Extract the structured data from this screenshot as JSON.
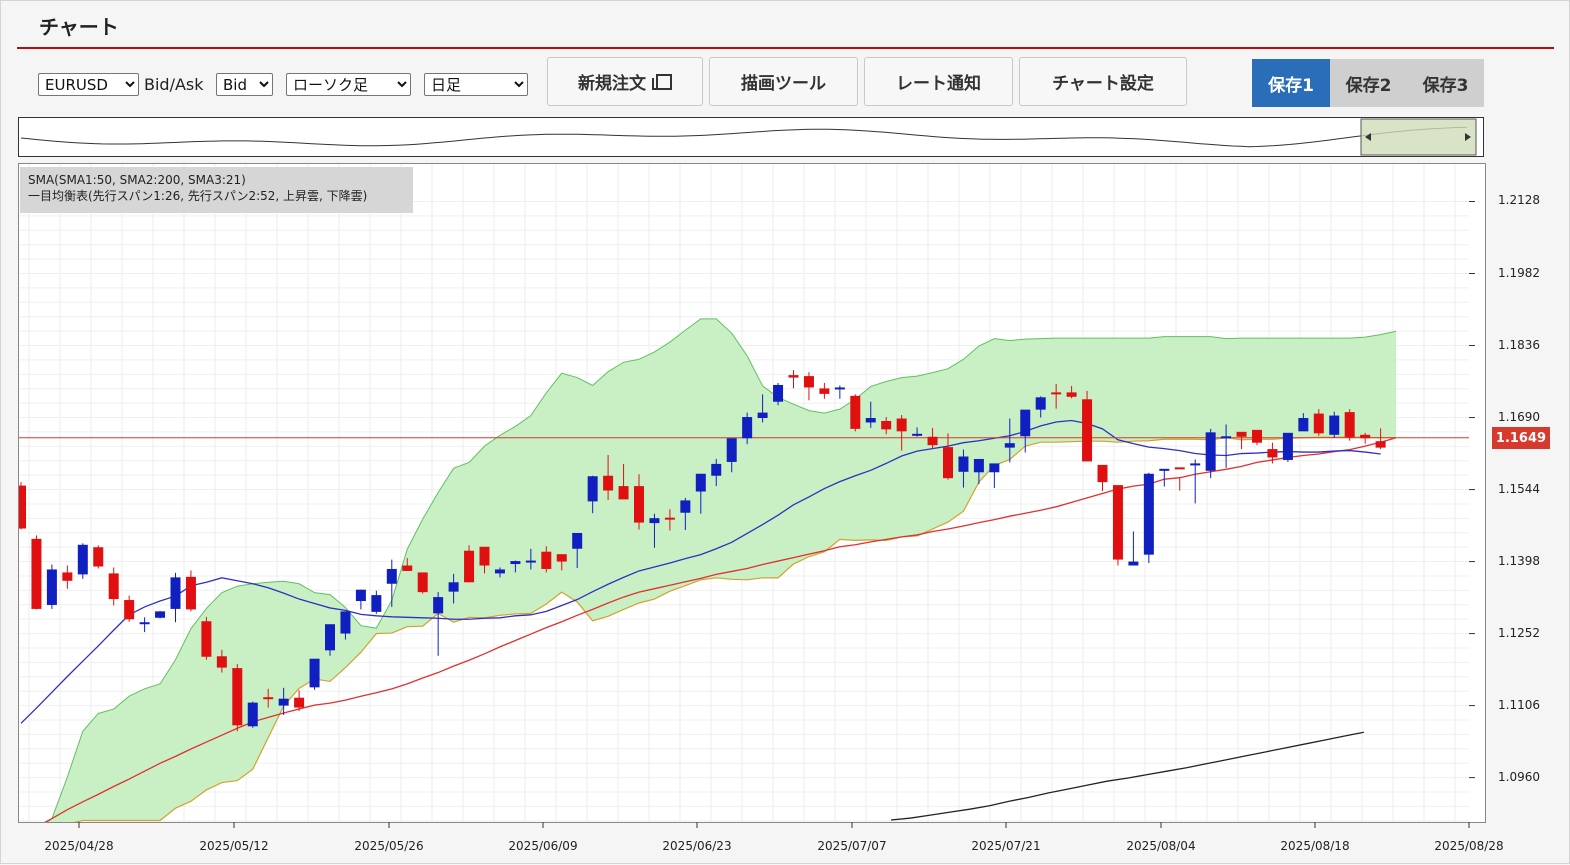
{
  "app": {
    "title": "チャート"
  },
  "toolbar": {
    "symbol": "EURUSD",
    "bidask_label": "Bid/Ask",
    "bidask_value": "Bid",
    "chart_type": "ローソク足",
    "timeframe": "日足",
    "new_order_label": "新規注文",
    "drawing_tools_label": "描画ツール",
    "rate_alert_label": "レート通知",
    "chart_settings_label": "チャート設定",
    "save_slots": [
      "保存1",
      "保存2",
      "保存3"
    ],
    "active_save_slot": "保存1"
  },
  "indicators": {
    "line1": "SMA(SMA1:50, SMA2:200, SMA3:21)",
    "line2": "一目均衡表(先行スパン1:26, 先行スパン2:52, 上昇雲, 下降雲)"
  },
  "current_price": "1.1649",
  "colors": {
    "accent": "#2a6db8",
    "title_rule": "#b01010",
    "bull": "#1020c0",
    "bear": "#e01010",
    "cloud": "#c9f0c4",
    "sma_blue": "#3030c0",
    "sma_red": "#e03030",
    "span2": "#d4a030",
    "price_line": "#d63a2e"
  },
  "chart_data": {
    "type": "candlestick",
    "x_ticks": [
      "2025/04/28",
      "2025/05/12",
      "2025/05/26",
      "2025/06/09",
      "2025/06/23",
      "2025/07/07",
      "2025/07/21",
      "2025/08/04",
      "2025/08/18",
      "2025/08/28"
    ],
    "y_ticks": [
      "1.2128",
      "1.1982",
      "1.1836",
      "1.1690",
      "1.1544",
      "1.1398",
      "1.1252",
      "1.1106",
      "1.0960"
    ],
    "ylim": [
      1.087,
      1.2204
    ],
    "ohlc": [
      [
        1.1552,
        1.1559,
        1.1463,
        1.1465
      ],
      [
        1.1444,
        1.1451,
        1.1301,
        1.1302
      ],
      [
        1.131,
        1.1392,
        1.1302,
        1.1382
      ],
      [
        1.1376,
        1.139,
        1.1343,
        1.1359
      ],
      [
        1.1372,
        1.1435,
        1.1363,
        1.1432
      ],
      [
        1.1427,
        1.1431,
        1.1384,
        1.1388
      ],
      [
        1.1374,
        1.1386,
        1.1309,
        1.1322
      ],
      [
        1.132,
        1.1329,
        1.1276,
        1.1281
      ],
      [
        1.1271,
        1.1285,
        1.1255,
        1.1275
      ],
      [
        1.1284,
        1.1298,
        1.1283,
        1.1297
      ],
      [
        1.1302,
        1.1375,
        1.1275,
        1.1366
      ],
      [
        1.1367,
        1.138,
        1.1297,
        1.1301
      ],
      [
        1.1277,
        1.1286,
        1.1199,
        1.1205
      ],
      [
        1.1206,
        1.1219,
        1.1173,
        1.1183
      ],
      [
        1.1182,
        1.119,
        1.1054,
        1.1066
      ],
      [
        1.1064,
        1.1114,
        1.1061,
        1.1112
      ],
      [
        1.1123,
        1.114,
        1.1102,
        1.112
      ],
      [
        1.1106,
        1.1142,
        1.1087,
        1.112
      ],
      [
        1.1122,
        1.1137,
        1.1095,
        1.1102
      ],
      [
        1.1143,
        1.1183,
        1.1138,
        1.1201
      ],
      [
        1.1218,
        1.1261,
        1.1207,
        1.1271
      ],
      [
        1.1252,
        1.1292,
        1.124,
        1.1297
      ],
      [
        1.1318,
        1.1341,
        1.1301,
        1.1341
      ],
      [
        1.1296,
        1.1339,
        1.1292,
        1.133
      ],
      [
        1.1353,
        1.1402,
        1.1306,
        1.1383
      ],
      [
        1.139,
        1.1405,
        1.1379,
        1.1379
      ],
      [
        1.1376,
        1.1373,
        1.1333,
        1.1336
      ],
      [
        1.1293,
        1.1336,
        1.1207,
        1.1326
      ],
      [
        1.1337,
        1.1373,
        1.1313,
        1.1356
      ],
      [
        1.142,
        1.1431,
        1.1356,
        1.1356
      ],
      [
        1.1428,
        1.1416,
        1.1374,
        1.139
      ],
      [
        1.1374,
        1.1386,
        1.1366,
        1.1382
      ],
      [
        1.1393,
        1.14,
        1.1376,
        1.1399
      ],
      [
        1.1397,
        1.1424,
        1.1382,
        1.14
      ],
      [
        1.1418,
        1.1429,
        1.1376,
        1.1383
      ],
      [
        1.1413,
        1.1412,
        1.138,
        1.1398
      ],
      [
        1.1424,
        1.1451,
        1.1385,
        1.1456
      ],
      [
        1.152,
        1.1572,
        1.1496,
        1.1571
      ],
      [
        1.1572,
        1.1614,
        1.1523,
        1.1542
      ],
      [
        1.1551,
        1.1596,
        1.1527,
        1.1524
      ],
      [
        1.1551,
        1.1575,
        1.1463,
        1.1477
      ],
      [
        1.1476,
        1.1495,
        1.1426,
        1.1486
      ],
      [
        1.1487,
        1.1504,
        1.1461,
        1.1485
      ],
      [
        1.1497,
        1.1527,
        1.1462,
        1.1522
      ],
      [
        1.154,
        1.1576,
        1.1495,
        1.1576
      ],
      [
        1.1572,
        1.1606,
        1.1551,
        1.1596
      ],
      [
        1.16,
        1.1648,
        1.1579,
        1.1648
      ],
      [
        1.1648,
        1.17,
        1.1636,
        1.1691
      ],
      [
        1.1689,
        1.1737,
        1.168,
        1.17
      ],
      [
        1.1722,
        1.176,
        1.1715,
        1.1756
      ],
      [
        1.1776,
        1.1786,
        1.1749,
        1.1771
      ],
      [
        1.1774,
        1.1782,
        1.1725,
        1.1751
      ],
      [
        1.1749,
        1.176,
        1.1728,
        1.1738
      ],
      [
        1.1747,
        1.1755,
        1.1728,
        1.1751
      ],
      [
        1.1734,
        1.1737,
        1.1662,
        1.1667
      ],
      [
        1.168,
        1.1722,
        1.1669,
        1.1689
      ],
      [
        1.1683,
        1.1691,
        1.1656,
        1.1666
      ],
      [
        1.1688,
        1.1695,
        1.1623,
        1.1662
      ],
      [
        1.1657,
        1.167,
        1.1651,
        1.1657
      ],
      [
        1.1651,
        1.1669,
        1.1627,
        1.1634
      ],
      [
        1.163,
        1.1658,
        1.1564,
        1.1567
      ],
      [
        1.158,
        1.1625,
        1.1548,
        1.1611
      ],
      [
        1.1579,
        1.1597,
        1.1555,
        1.1606
      ],
      [
        1.1579,
        1.1588,
        1.1547,
        1.1597
      ],
      [
        1.1629,
        1.1688,
        1.1599,
        1.1638
      ],
      [
        1.1652,
        1.1687,
        1.1619,
        1.1706
      ],
      [
        1.1706,
        1.1733,
        1.169,
        1.1731
      ],
      [
        1.1741,
        1.1758,
        1.1708,
        1.1737
      ],
      [
        1.1741,
        1.1754,
        1.1729,
        1.1732
      ],
      [
        1.1727,
        1.1744,
        1.1616,
        1.1601
      ],
      [
        1.1594,
        1.1562,
        1.1541,
        1.1559
      ],
      [
        1.1553,
        1.155,
        1.139,
        1.1402
      ],
      [
        1.139,
        1.1459,
        1.1395,
        1.1398
      ],
      [
        1.1412,
        1.1578,
        1.1395,
        1.1576
      ],
      [
        1.1582,
        1.1585,
        1.155,
        1.1586
      ],
      [
        1.1589,
        1.1567,
        1.1542,
        1.1586
      ],
      [
        1.1597,
        1.1605,
        1.1516,
        1.1597
      ],
      [
        1.1582,
        1.1667,
        1.1567,
        1.166
      ],
      [
        1.165,
        1.1676,
        1.1588,
        1.1652
      ],
      [
        1.1661,
        1.1659,
        1.1626,
        1.1651
      ],
      [
        1.1665,
        1.1659,
        1.1634,
        1.1639
      ],
      [
        1.1626,
        1.1639,
        1.1597,
        1.1609
      ],
      [
        1.1604,
        1.1622,
        1.16,
        1.1659
      ],
      [
        1.1662,
        1.1699,
        1.1678,
        1.1689
      ],
      [
        1.1698,
        1.1707,
        1.1653,
        1.1658
      ],
      [
        1.1655,
        1.1702,
        1.1649,
        1.1694
      ],
      [
        1.1701,
        1.1707,
        1.1643,
        1.165
      ],
      [
        1.1655,
        1.1659,
        1.1637,
        1.1648
      ],
      [
        1.1642,
        1.1668,
        1.1626,
        1.1629
      ]
    ],
    "sma21": [
      1.107,
      1.1101,
      1.1133,
      1.1165,
      1.1196,
      1.1227,
      1.1259,
      1.129,
      1.1306,
      1.1318,
      1.1328,
      1.1349,
      1.1356,
      1.1365,
      1.1359,
      1.1353,
      1.1345,
      1.1334,
      1.1322,
      1.1313,
      1.1304,
      1.1299,
      1.1291,
      1.1288,
      1.1286,
      1.1285,
      1.1284,
      1.1283,
      1.1281,
      1.1281,
      1.1283,
      1.1284,
      1.1288,
      1.129,
      1.1297,
      1.1309,
      1.1321,
      1.1337,
      1.1352,
      1.1366,
      1.1379,
      1.1387,
      1.1395,
      1.1404,
      1.1412,
      1.1424,
      1.1437,
      1.1455,
      1.1473,
      1.1492,
      1.1513,
      1.1529,
      1.1546,
      1.156,
      1.1572,
      1.1583,
      1.1597,
      1.1612,
      1.1622,
      1.1627,
      1.1632,
      1.1639,
      1.1643,
      1.1648,
      1.1653,
      1.1662,
      1.1673,
      1.1681,
      1.1684,
      1.1678,
      1.1667,
      1.1645,
      1.1637,
      1.163,
      1.1627,
      1.1623,
      1.1617,
      1.1614,
      1.1613,
      1.1617,
      1.1618,
      1.162,
      1.1621,
      1.162,
      1.162,
      1.1622,
      1.1623,
      1.162,
      1.1616
    ],
    "sma50": [
      1.0843,
      1.086,
      1.0877,
      1.0895,
      1.0911,
      1.0926,
      1.0942,
      1.0957,
      1.0973,
      1.0989,
      1.1003,
      1.1018,
      1.1032,
      1.1046,
      1.106,
      1.1073,
      1.1082,
      1.1091,
      1.1099,
      1.1107,
      1.1111,
      1.1117,
      1.1125,
      1.1132,
      1.114,
      1.115,
      1.1162,
      1.1173,
      1.1186,
      1.1198,
      1.1211,
      1.1225,
      1.1238,
      1.1251,
      1.1264,
      1.1276,
      1.1289,
      1.1301,
      1.1314,
      1.1326,
      1.1336,
      1.1343,
      1.135,
      1.1357,
      1.1364,
      1.1372,
      1.1378,
      1.1384,
      1.1392,
      1.1399,
      1.1406,
      1.1413,
      1.142,
      1.1428,
      1.1432,
      1.1438,
      1.1443,
      1.1448,
      1.1452,
      1.1459,
      1.1464,
      1.147,
      1.1477,
      1.1483,
      1.149,
      1.1496,
      1.1502,
      1.1509,
      1.1518,
      1.1527,
      1.1536,
      1.1545,
      1.1551,
      1.1555,
      1.1565,
      1.1568,
      1.1575,
      1.158,
      1.1585,
      1.1591,
      1.1599,
      1.1604,
      1.1609,
      1.1613,
      1.1616,
      1.1621,
      1.1625,
      1.1632,
      1.164,
      1.1649
    ],
    "sma200_segment": [
      [
        1.0874,
        1.0878,
        1.0884,
        1.089,
        1.0896,
        1.0903,
        1.0912,
        1.092,
        1.0929,
        1.0937,
        1.0945,
        1.0953,
        1.0959,
        1.0966,
        1.0973,
        1.098,
        1.0988,
        1.0996,
        1.1004,
        1.1012,
        1.102,
        1.1028,
        1.1036,
        1.1044,
        1.1052
      ]
    ],
    "senkou_span1": [
      1.086,
      1.0853,
      1.0877,
      1.0961,
      1.1054,
      1.109,
      1.1099,
      1.1125,
      1.114,
      1.115,
      1.1199,
      1.1262,
      1.1303,
      1.1335,
      1.1348,
      1.1353,
      1.1356,
      1.1358,
      1.1353,
      1.1335,
      1.1331,
      1.1305,
      1.1268,
      1.1263,
      1.1253,
      1.1266,
      1.1267,
      1.1293,
      1.1275,
      1.1285,
      1.1284,
      1.1289,
      1.1292,
      1.1293,
      1.1312,
      1.1336,
      1.1316,
      1.1278,
      1.1287,
      1.1301,
      1.1314,
      1.1322,
      1.1338,
      1.1349,
      1.1361,
      1.1365,
      1.1362,
      1.1361,
      1.1365,
      1.1365,
      1.1393,
      1.1408,
      1.1418,
      1.1443,
      1.1441,
      1.1442,
      1.1441,
      1.1448,
      1.145,
      1.1464,
      1.1478,
      1.15,
      1.1559,
      1.1593,
      1.1605,
      1.1632,
      1.164,
      1.164,
      1.1641,
      1.1642,
      1.1642,
      1.164,
      1.1642,
      1.1643,
      1.1646,
      1.1646,
      1.1646,
      1.1645,
      1.1649,
      1.1645,
      1.1646,
      1.1646,
      1.1648,
      1.1649,
      1.165,
      1.165,
      1.165,
      1.165,
      1.1649,
      1.1649
    ],
    "senkou_span2": [
      1.0837,
      1.0844,
      1.0864,
      1.0866,
      1.0873,
      1.0873,
      1.0873,
      1.0873,
      1.0873,
      1.0873,
      1.0898,
      1.0912,
      1.0935,
      1.095,
      1.0954,
      1.0977,
      1.1041,
      1.1105,
      1.1141,
      1.116,
      1.1155,
      1.1183,
      1.1214,
      1.1252,
      1.1319,
      1.1423,
      1.1484,
      1.1538,
      1.1587,
      1.1599,
      1.1632,
      1.1654,
      1.1672,
      1.1694,
      1.174,
      1.178,
      1.1771,
      1.1755,
      1.1783,
      1.1802,
      1.1808,
      1.1823,
      1.1843,
      1.1867,
      1.189,
      1.189,
      1.1861,
      1.1815,
      1.1754,
      1.1731,
      1.1717,
      1.1704,
      1.1699,
      1.1707,
      1.1727,
      1.1753,
      1.1763,
      1.1771,
      1.1774,
      1.1781,
      1.1789,
      1.1808,
      1.1835,
      1.185,
      1.1846,
      1.1849,
      1.185,
      1.1851,
      1.1851,
      1.1851,
      1.1851,
      1.1851,
      1.1851,
      1.1851,
      1.1854,
      1.1854,
      1.1854,
      1.1854,
      1.185,
      1.1851,
      1.1851,
      1.1851,
      1.1851,
      1.1851,
      1.1851,
      1.1851,
      1.1851,
      1.1853,
      1.1858,
      1.1865
    ]
  },
  "navigator": {
    "description_visible": false
  }
}
